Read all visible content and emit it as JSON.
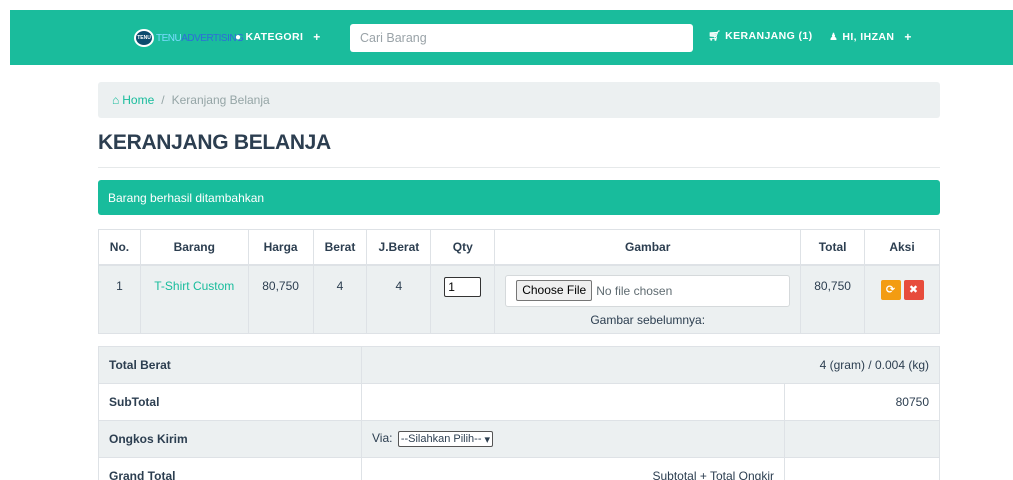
{
  "navbar": {
    "brand_text": "ADVERTISING",
    "brand_accent": "TENU",
    "kategori_label": "KATEGORI",
    "search_placeholder": "Cari Barang",
    "cart_label": "KERANJANG (1)",
    "user_label": "HI, IHZAN",
    "bg_color": "#1abc9c"
  },
  "breadcrumb": {
    "home": "Home",
    "separator": "/",
    "current": "Keranjang Belanja"
  },
  "page": {
    "title": "KERANJANG BELANJA"
  },
  "alert": {
    "message": "Barang berhasil ditambahkan"
  },
  "cart_table": {
    "headers": [
      "No.",
      "Barang",
      "Harga",
      "Berat",
      "J.Berat",
      "Qty",
      "Gambar",
      "Total",
      "Aksi"
    ],
    "rows": [
      {
        "no": "1",
        "barang": "T-Shirt Custom",
        "harga": "80,750",
        "berat": "4",
        "jberat": "4",
        "qty": "1",
        "file_button": "Choose File",
        "file_status": "No file chosen",
        "prev_image_label": "Gambar sebelumnya:",
        "total": "80,750",
        "update_icon": "refresh-icon",
        "delete_icon": "close-icon"
      }
    ]
  },
  "summary": {
    "total_berat_label": "Total Berat",
    "total_berat_value": "4 (gram) / 0.004 (kg)",
    "subtotal_label": "SubTotal",
    "subtotal_value": "80750",
    "ongkir_label": "Ongkos Kirim",
    "via_label": "Via:",
    "via_selected": "--Silahkan Pilih--",
    "grand_total_label": "Grand Total",
    "grand_total_formula": "Subtotal + Total Ongkir"
  },
  "colors": {
    "accent": "#18bc9c",
    "warning": "#f39c12",
    "danger": "#e74c3c"
  }
}
